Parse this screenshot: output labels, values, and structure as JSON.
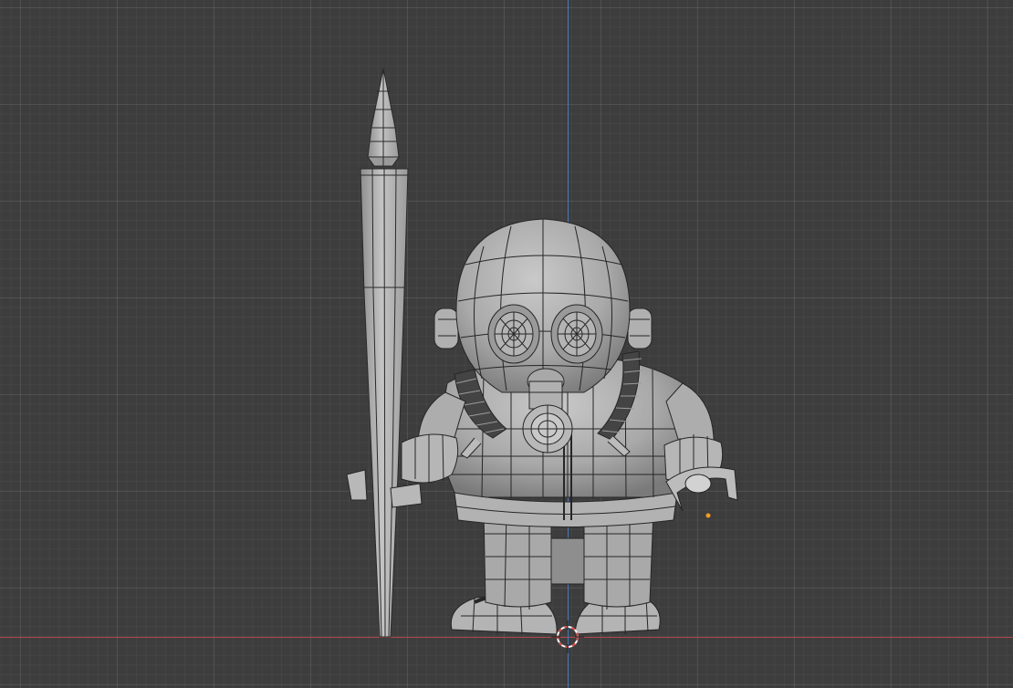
{
  "viewport": {
    "background": "#3d3d3d",
    "axis_x_color": "#b0474f",
    "axis_z_color": "#4f78b8",
    "origin_color": "#f59b1e",
    "cursor_colors": [
      "#d84848",
      "#ffffff"
    ]
  },
  "scene": {
    "objects": [
      {
        "name": "spear",
        "icon": "spear-mesh"
      },
      {
        "name": "character",
        "icon": "gas-mask-character-mesh"
      }
    ],
    "shading": "solid-wireframe"
  }
}
